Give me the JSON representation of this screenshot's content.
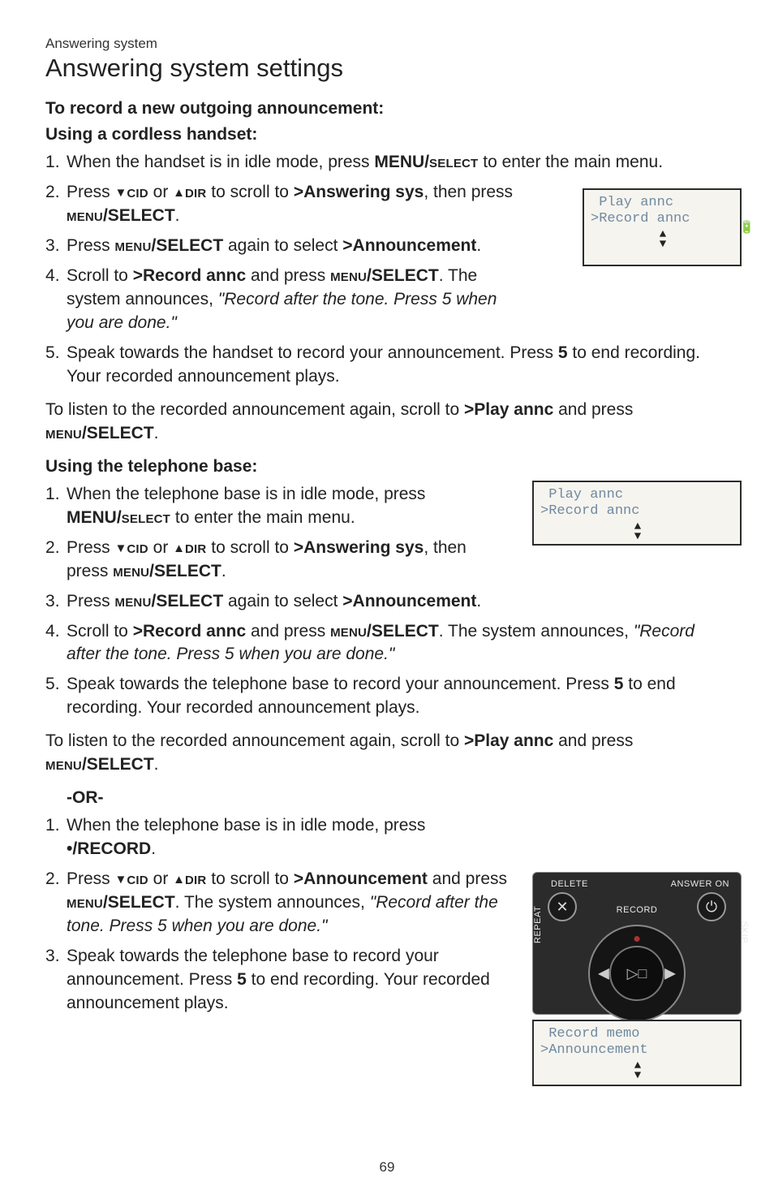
{
  "header": {
    "breadcrumb": "Answering system",
    "title": "Answering system settings"
  },
  "sec1": {
    "heading": "To record a new outgoing announcement:",
    "sub_a": "Using a cordless handset:",
    "step1_a": "When the handset is in idle mode, press ",
    "step1_b": "MENU/",
    "step1_c": "select",
    "step1_d": " to enter the main menu.",
    "step2_a": "Press ",
    "step2_cid": "cid",
    "step2_or": " or ",
    "step2_dir": "dir",
    "step2_b": " to scroll to ",
    "step2_target": ">Answering sys",
    "step2_c": ", then press ",
    "step2_ms": "menu",
    "step2_sel": "/SELECT",
    "step2_end": ".",
    "step3_a": "Press ",
    "step3_b": " again to select ",
    "step3_target": ">Announcement",
    "step3_end": ".",
    "step4_a": "Scroll to ",
    "step4_target": ">Record annc",
    "step4_b": " and press ",
    "step4_c": ".  The system announces, ",
    "step4_quote": "\"Record after the tone. Press 5 when you are done.\"",
    "step5_a": "Speak towards the handset to record your announcement. Press ",
    "step5_key": "5",
    "step5_b": " to end recording. Your recorded announcement plays.",
    "listen_a": "To listen to the recorded announcement again, scroll to ",
    "listen_target": ">Play annc",
    "listen_b": " and press ",
    "listen_end": "."
  },
  "sec2": {
    "sub": "Using the telephone base:",
    "step1_a": "When the telephone base is in idle mode, press ",
    "step1_b": "MENU/",
    "step1_c": "select",
    "step1_d": " to enter the main menu.",
    "step2_a": "Press ",
    "step2_b": " to scroll to ",
    "step2_target": ">Answering sys",
    "step2_c": ", then press ",
    "step3_a": "Press ",
    "step3_b": " again to select ",
    "step3_target": ">Announcement",
    "step3_end": ".",
    "step4_a": "Scroll to ",
    "step4_target": ">Record annc",
    "step4_b": " and press ",
    "step4_c": ". The system announces, ",
    "step4_quote": "\"Record after the tone. Press 5 when you are done.\"",
    "step5_a": "Speak towards the telephone base to record your announcement. Press ",
    "step5_key": "5",
    "step5_b": " to end recording. Your recorded announcement plays.",
    "listen_a": "To listen to the recorded announcement again, scroll to ",
    "listen_target": ">Play annc",
    "listen_b": " and press ",
    "listen_end": "."
  },
  "or_label": "-OR-",
  "sec3": {
    "step1_a": "When the telephone base is in idle mode, press ",
    "step1_rec": "•/RECORD",
    "step1_end": ".",
    "step2_a": "Press ",
    "step2_b": " to scroll to ",
    "step2_target": ">Announcement",
    "step2_c": " and press ",
    "step2_d": ". The system announces, ",
    "step2_quote": "\"Record after the tone. Press 5 when you are done.\"",
    "step3_a": "Speak towards the telephone base to record your announcement. Press ",
    "step3_key": "5",
    "step3_b": " to end recording. Your recorded announcement plays."
  },
  "lcd1": {
    "line1": " Play annc",
    "line2": ">Record annc",
    "arrows": "▲\n▼"
  },
  "lcd2": {
    "line1": " Play annc",
    "line2": ">Record annc",
    "arrows": "▲\n▼"
  },
  "lcd3": {
    "line1": " Record memo",
    "line2": ">Announcement",
    "arrows": "▲\n▼"
  },
  "phone": {
    "delete": "DELETE",
    "answer": "ANSWER ON",
    "record": "RECORD",
    "repeat": "REPEAT",
    "skip": "SKIP",
    "x": "✕",
    "pwr": "⏻",
    "play": "▷□",
    "left": "◀◀",
    "right": "▶▶"
  },
  "shared": {
    "menu_sc": "menu",
    "select": "/SELECT",
    "cid": "cid",
    "dir": "dir",
    "or": " or "
  },
  "page_number": "69"
}
